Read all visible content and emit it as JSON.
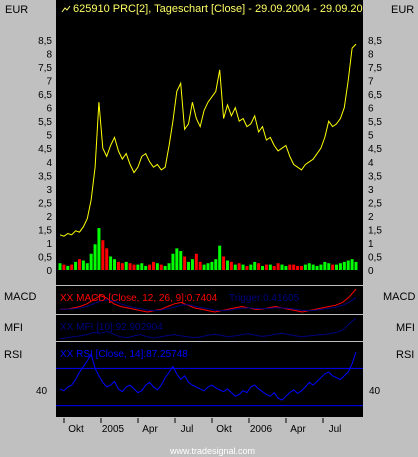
{
  "chart_data": [
    {
      "type": "line",
      "panel": "price",
      "title": "625910  PRC[2], Tageschart [Close] - 29.09.2004 - 29.09.20",
      "ylabel": "EUR",
      "y_ticks": [
        "0",
        "0,5",
        "1",
        "1,5",
        "2",
        "2,5",
        "3",
        "3,5",
        "4",
        "4,5",
        "5",
        "5,5",
        "6",
        "6,5",
        "7",
        "7,5",
        "8",
        "8,5"
      ],
      "ylim": [
        0,
        8.5
      ],
      "series": [
        {
          "color": "#ffff00",
          "values": [
            1.3,
            1.25,
            1.35,
            1.3,
            1.45,
            1.4,
            1.6,
            1.9,
            2.6,
            3.8,
            6.2,
            4.5,
            4.2,
            4.6,
            4.9,
            4.4,
            4.1,
            4.3,
            3.9,
            3.6,
            3.8,
            4.2,
            4.3,
            4.0,
            3.8,
            3.9,
            3.7,
            3.8,
            4.6,
            5.5,
            6.6,
            6.9,
            5.2,
            5.4,
            6.2,
            5.6,
            5.3,
            5.9,
            6.2,
            6.4,
            6.6,
            7.4,
            5.6,
            6.1,
            5.7,
            6.0,
            5.5,
            5.6,
            5.3,
            5.4,
            5.7,
            5.1,
            5.3,
            4.8,
            4.9,
            4.6,
            4.4,
            4.5,
            4.6,
            4.2,
            3.9,
            3.8,
            3.7,
            3.9,
            4.0,
            4.1,
            4.3,
            4.5,
            4.9,
            5.5,
            5.3,
            5.4,
            5.6,
            6.0,
            7.0,
            8.2,
            8.35
          ]
        }
      ],
      "volume": {
        "color_up": "#00ff00",
        "color_down": "#ff0000",
        "values": [
          0.25,
          0.2,
          0.15,
          0.2,
          0.3,
          0.4,
          0.35,
          0.25,
          0.6,
          0.95,
          1.55,
          1.1,
          0.8,
          0.5,
          0.4,
          0.3,
          0.25,
          0.3,
          0.25,
          0.2,
          0.2,
          0.25,
          0.15,
          0.2,
          0.3,
          0.25,
          0.2,
          0.15,
          0.25,
          0.6,
          0.8,
          0.7,
          0.5,
          0.3,
          0.4,
          0.6,
          0.3,
          0.2,
          0.25,
          0.3,
          0.4,
          0.9,
          0.5,
          0.35,
          0.3,
          0.2,
          0.25,
          0.2,
          0.15,
          0.2,
          0.3,
          0.25,
          0.15,
          0.2,
          0.2,
          0.15,
          0.25,
          0.2,
          0.15,
          0.2,
          0.2,
          0.15,
          0.15,
          0.2,
          0.25,
          0.2,
          0.15,
          0.2,
          0.3,
          0.25,
          0.2,
          0.2,
          0.25,
          0.3,
          0.35,
          0.4,
          0.3
        ]
      }
    },
    {
      "type": "line",
      "panel": "macd",
      "label": "MACD",
      "legend": [
        {
          "text": "XX MACD [Close, 12, 26, 9]:0.7404",
          "color": "#ff0000"
        },
        {
          "text": "Trigger:0.41605",
          "color": "#000080"
        }
      ],
      "series": [
        {
          "color": "#ff0000",
          "values": [
            0.0,
            0.0,
            0.05,
            0.1,
            0.2,
            0.35,
            0.5,
            0.4,
            0.2,
            0.1,
            0.05,
            0.0,
            -0.05,
            -0.1,
            -0.05,
            0.0,
            0.1,
            0.2,
            0.25,
            0.15,
            0.05,
            0.0,
            -0.05,
            -0.1,
            -0.05,
            0.0,
            0.05,
            0.1,
            0.05,
            0.0,
            0.0,
            0.05,
            0.1,
            0.05,
            0.0,
            -0.05,
            -0.1,
            -0.05,
            0.0,
            0.05,
            0.1,
            0.15,
            0.25,
            0.45,
            0.74
          ]
        },
        {
          "color": "#000080",
          "values": [
            0.0,
            0.0,
            0.02,
            0.05,
            0.1,
            0.2,
            0.3,
            0.35,
            0.3,
            0.2,
            0.12,
            0.06,
            0.02,
            -0.03,
            -0.05,
            -0.03,
            0.02,
            0.08,
            0.15,
            0.17,
            0.12,
            0.06,
            0.02,
            -0.03,
            -0.05,
            -0.03,
            0.0,
            0.04,
            0.05,
            0.03,
            0.02,
            0.03,
            0.05,
            0.05,
            0.03,
            0.0,
            -0.04,
            -0.05,
            -0.03,
            0.0,
            0.04,
            0.08,
            0.14,
            0.26,
            0.42
          ]
        }
      ]
    },
    {
      "type": "line",
      "panel": "mfi",
      "label": "MFI",
      "legend": [
        {
          "text": "XX MFI [10]:92.902904",
          "color": "#000080"
        }
      ],
      "series": [
        {
          "color": "#000080",
          "values": [
            45,
            48,
            50,
            52,
            55,
            60,
            58,
            62,
            56,
            50,
            48,
            52,
            55,
            50,
            47,
            50,
            53,
            55,
            52,
            50,
            48,
            50,
            54,
            56,
            53,
            50,
            52,
            55,
            57,
            54,
            51,
            53,
            56,
            58,
            55,
            52,
            50,
            52,
            54,
            55,
            57,
            60,
            65,
            80,
            92.9
          ]
        }
      ]
    },
    {
      "type": "line",
      "panel": "rsi",
      "label": "RSI",
      "legend": [
        {
          "text": "XX RSI [Close, 14]:87.25748",
          "color": "#0000ff"
        }
      ],
      "y_ticks": [
        "40"
      ],
      "reference_lines": [
        70,
        30
      ],
      "ylim": [
        20,
        95
      ],
      "series": [
        {
          "color": "#0000ff",
          "values": [
            48,
            46,
            50,
            52,
            58,
            66,
            72,
            78,
            85,
            70,
            62,
            55,
            50,
            52,
            56,
            48,
            45,
            50,
            52,
            48,
            44,
            46,
            52,
            55,
            50,
            47,
            52,
            60,
            66,
            72,
            64,
            58,
            62,
            55,
            52,
            50,
            48,
            46,
            50,
            52,
            49,
            47,
            45,
            48,
            44,
            40,
            42,
            46,
            44,
            50,
            52,
            48,
            45,
            42,
            40,
            44,
            38,
            36,
            40,
            44,
            47,
            43,
            46,
            50,
            55,
            52,
            56,
            60,
            64,
            66,
            62,
            60,
            58,
            62,
            66,
            75,
            87.3
          ]
        }
      ]
    }
  ],
  "x_axis": {
    "tick_labels": [
      "Okt",
      "2005",
      "Apr",
      "Jul",
      "Okt",
      "2006",
      "Apr",
      "Jul"
    ]
  },
  "watermark": "www.tradesignal.com"
}
